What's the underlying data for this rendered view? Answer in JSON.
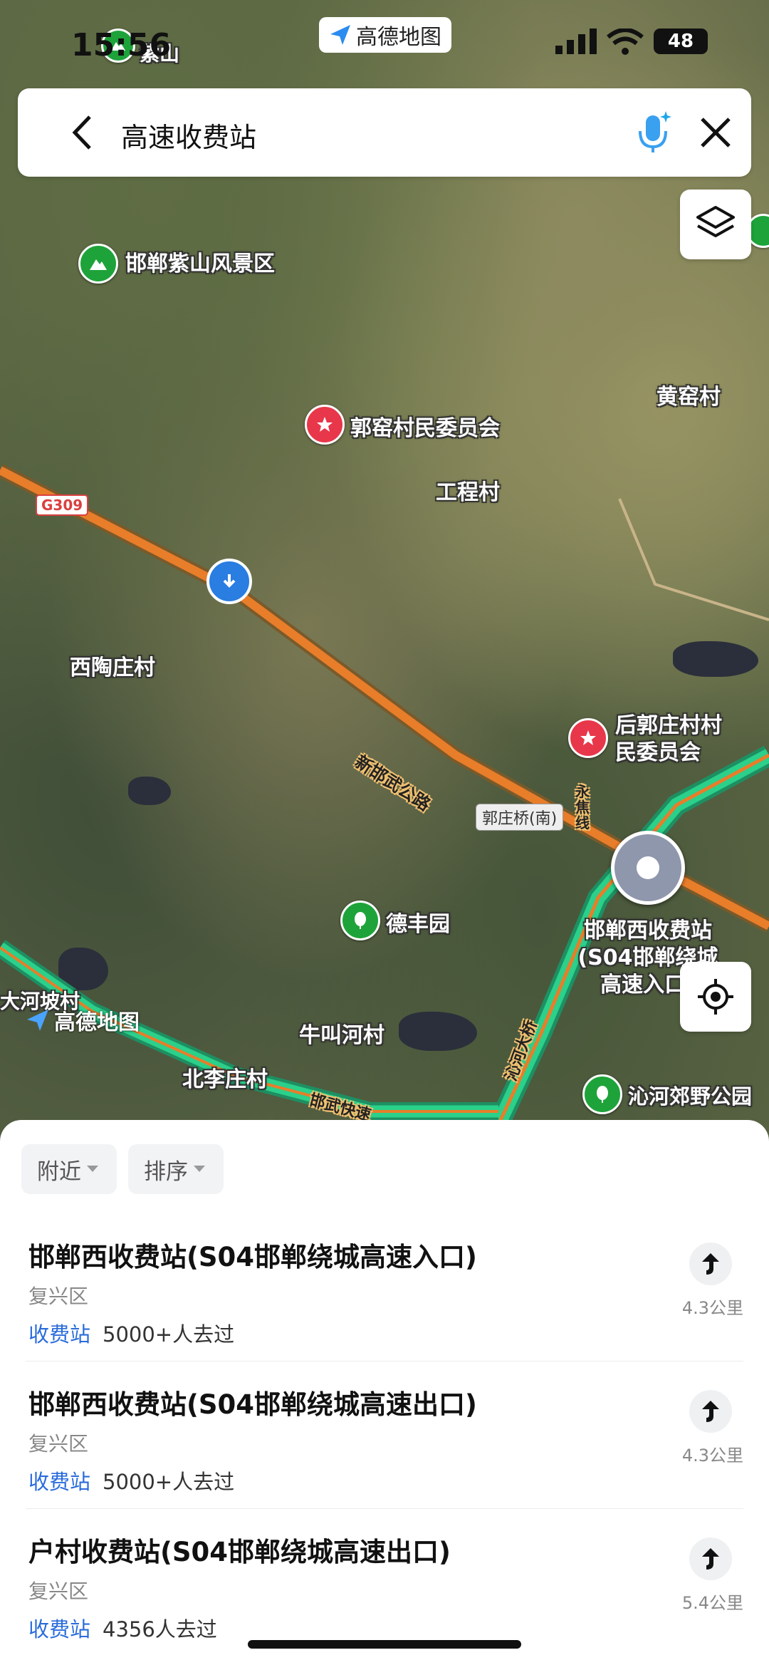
{
  "status_bar": {
    "time": "15:56",
    "app_badge": "高德地图",
    "battery": "48"
  },
  "search": {
    "back_icon": "chevron-left-icon",
    "query": "高速收费站",
    "voice_icon": "microphone-icon",
    "clear_icon": "close-icon"
  },
  "map": {
    "labels": {
      "zishan_short": "紫山",
      "zishan_area": "邯郸紫山风景区",
      "guoyao_committee": "郭窑村民委员会",
      "huangyao": "黄窑村",
      "gongcheng": "工程村",
      "xitaozhuang": "西陶庄村",
      "houguo_committee": "后郭庄村村民委员会",
      "defeng": "德丰园",
      "toll_station": "邯郸西收费站(S04邯郸绕城高速入口)",
      "niujiaohe": "牛叫河村",
      "beilizhuang": "北李庄村",
      "qinhe_park": "沁河郊野公园",
      "dahepo": "大河坡村"
    },
    "roads": {
      "g309": "G309",
      "xinhanwu": "新邯武公路",
      "guozhuangqiao": "郭庄桥(南)",
      "yongjiao": "永焦线",
      "qinhe_bridge": "沁河大桥",
      "hanwu_fast": "邯武快速"
    },
    "watermark": "高德地图"
  },
  "filters": [
    {
      "label": "附近"
    },
    {
      "label": "排序"
    }
  ],
  "results": [
    {
      "title": "邯郸西收费站(S04邯郸绕城高速入口)",
      "district": "复兴区",
      "category": "收费站",
      "visits": "5000+人去过",
      "distance": "4.3公里"
    },
    {
      "title": "邯郸西收费站(S04邯郸绕城高速出口)",
      "district": "复兴区",
      "category": "收费站",
      "visits": "5000+人去过",
      "distance": "4.3公里"
    },
    {
      "title": "户村收费站(S04邯郸绕城高速出口)",
      "district": "复兴区",
      "category": "收费站",
      "visits": "4356人去过",
      "distance": "5.4公里"
    }
  ],
  "colors": {
    "accent": "#2a6cdb",
    "poi_green": "#1ea33a",
    "poi_red": "#e8374a",
    "highway": "#2bd08a",
    "road": "#f08a2a"
  }
}
